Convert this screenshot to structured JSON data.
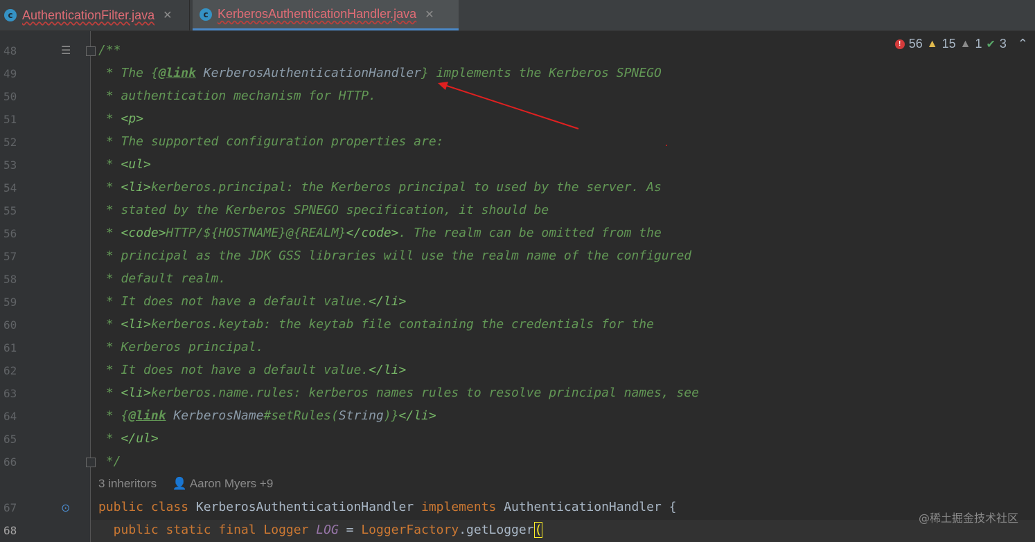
{
  "tabs": [
    {
      "icon": "class-icon",
      "label": "AuthenticationFilter.java"
    },
    {
      "icon": "class-icon",
      "label": "KerberosAuthenticationHandler.java"
    }
  ],
  "status": {
    "errors": "56",
    "warnings": "15",
    "weak_warnings": "1",
    "typos": "3"
  },
  "line_numbers": [
    "48",
    "49",
    "50",
    "51",
    "52",
    "53",
    "54",
    "55",
    "56",
    "57",
    "58",
    "59",
    "60",
    "61",
    "62",
    "63",
    "64",
    "65",
    "66",
    "67",
    "68"
  ],
  "code": {
    "l48": "/**",
    "l49_a": " * The {",
    "l49_link": "@link",
    "l49_ref": " KerberosAuthenticationHandler",
    "l49_b": "} implements the Kerberos SPNEGO",
    "l50": " * authentication mechanism for HTTP.",
    "l51_a": " * ",
    "l51_tag": "<p>",
    "l52": " * The supported configuration properties are:",
    "l53_a": " * ",
    "l53_tag": "<ul>",
    "l54_a": " * ",
    "l54_tag": "<li>",
    "l54_b": "kerberos.principal: the Kerberos principal to used by the server. As",
    "l55": " * stated by the Kerberos SPNEGO specification, it should be",
    "l56_a": " * ",
    "l56_tag1": "<code>",
    "l56_b": "HTTP/${HOSTNAME}@{REALM}",
    "l56_tag2": "</code>",
    "l56_c": ". The realm can be omitted from the",
    "l57": " * principal as the JDK GSS libraries will use the realm name of the configured",
    "l58": " * default realm.",
    "l59_a": " * It does not have a default value.",
    "l59_tag": "</li>",
    "l60_a": " * ",
    "l60_tag": "<li>",
    "l60_b": "kerberos.keytab: the keytab file containing the credentials for the",
    "l61": " * Kerberos principal.",
    "l62_a": " * It does not have a default value.",
    "l62_tag": "</li>",
    "l63_a": " * ",
    "l63_tag": "<li>",
    "l63_b": "kerberos.name.rules: kerberos names rules to resolve principal names, see",
    "l64_a": " * {",
    "l64_link": "@link",
    "l64_ref": " KerberosName",
    "l64_b": "#setRules(",
    "l64_ref2": "String",
    "l64_c": ")}",
    "l64_tag": "</li>",
    "l65_a": " * ",
    "l65_tag": "</ul>",
    "l66": " */",
    "l67_kw1": "public class",
    "l67_name": " KerberosAuthenticationHandler ",
    "l67_kw2": "implements",
    "l67_iface": " AuthenticationHandler {",
    "l68_kw": "  public static final",
    "l68_type": " Logger",
    "l68_field": " LOG",
    "l68_eq": " = ",
    "l68_cls": "LoggerFactory",
    "l68_call": ".getLogger",
    "l68_paren": "("
  },
  "inlay": {
    "inheritors": "3 inheritors",
    "author": "Aaron Myers +9"
  },
  "watermark": "@稀土掘金技术社区",
  "colors": {
    "comment": "#629755",
    "keyword": "#cc7832",
    "background": "#2b2b2b",
    "arrow": "#e02020"
  }
}
